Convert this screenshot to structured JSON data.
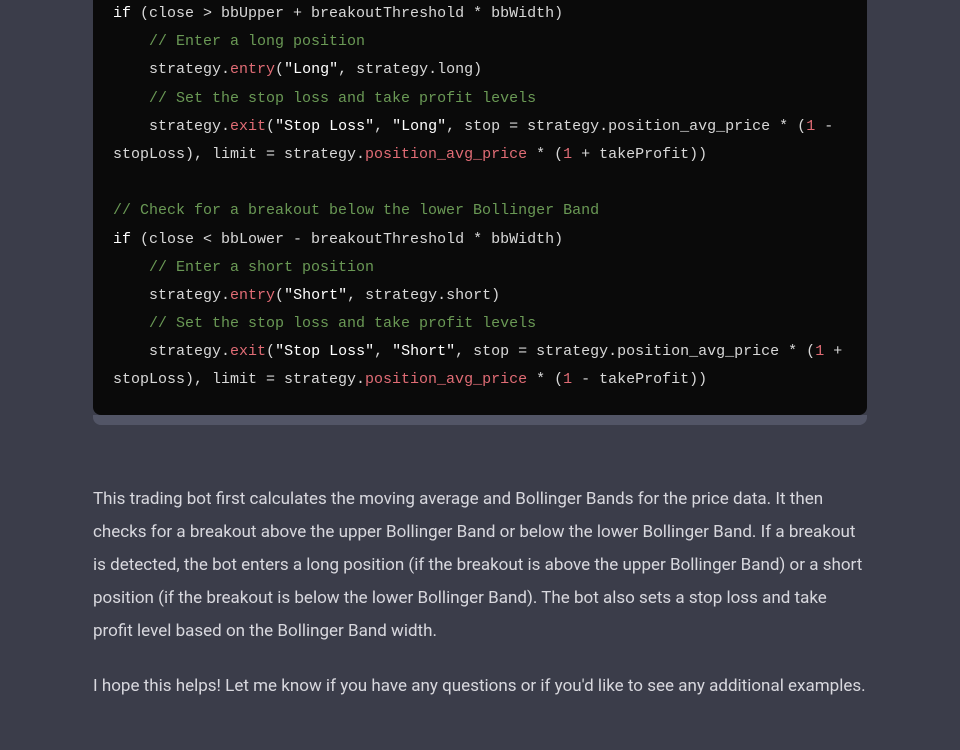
{
  "code": {
    "lines": [
      {
        "indent": 0,
        "segments": [
          {
            "cls": "kw",
            "text": "if"
          },
          {
            "cls": "",
            "text": " (close > bbUpper + breakoutThreshold * bbWidth)"
          }
        ]
      },
      {
        "indent": 1,
        "segments": [
          {
            "cls": "comment",
            "text": "// Enter a long position"
          }
        ]
      },
      {
        "indent": 1,
        "segments": [
          {
            "cls": "",
            "text": "strategy."
          },
          {
            "cls": "method",
            "text": "entry"
          },
          {
            "cls": "",
            "text": "("
          },
          {
            "cls": "str",
            "text": "\"Long\""
          },
          {
            "cls": "",
            "text": ", strategy.long)"
          }
        ]
      },
      {
        "indent": 1,
        "segments": [
          {
            "cls": "comment",
            "text": "// Set the stop loss and take profit levels"
          }
        ]
      },
      {
        "indent": 1,
        "segments": [
          {
            "cls": "",
            "text": "strategy."
          },
          {
            "cls": "method",
            "text": "exit"
          },
          {
            "cls": "",
            "text": "("
          },
          {
            "cls": "str",
            "text": "\"Stop Loss\""
          },
          {
            "cls": "",
            "text": ", "
          },
          {
            "cls": "str",
            "text": "\"Long\""
          },
          {
            "cls": "",
            "text": ", stop = strategy.position_avg_price * ("
          },
          {
            "cls": "num",
            "text": "1"
          },
          {
            "cls": "",
            "text": " - stopLoss), limit = strategy."
          },
          {
            "cls": "method2",
            "text": "position_avg_price"
          },
          {
            "cls": "",
            "text": " * ("
          },
          {
            "cls": "num",
            "text": "1"
          },
          {
            "cls": "",
            "text": " + takeProfit))"
          }
        ]
      },
      {
        "indent": 0,
        "segments": [
          {
            "cls": "",
            "text": ""
          }
        ]
      },
      {
        "indent": 0,
        "segments": [
          {
            "cls": "comment",
            "text": "// Check for a breakout below the lower Bollinger Band"
          }
        ]
      },
      {
        "indent": 0,
        "segments": [
          {
            "cls": "kw",
            "text": "if"
          },
          {
            "cls": "",
            "text": " (close < bbLower - breakoutThreshold * bbWidth)"
          }
        ]
      },
      {
        "indent": 1,
        "segments": [
          {
            "cls": "comment",
            "text": "// Enter a short position"
          }
        ]
      },
      {
        "indent": 1,
        "segments": [
          {
            "cls": "",
            "text": "strategy."
          },
          {
            "cls": "method",
            "text": "entry"
          },
          {
            "cls": "",
            "text": "("
          },
          {
            "cls": "str",
            "text": "\"Short\""
          },
          {
            "cls": "",
            "text": ", strategy.short)"
          }
        ]
      },
      {
        "indent": 1,
        "segments": [
          {
            "cls": "comment",
            "text": "// Set the stop loss and take profit levels"
          }
        ]
      },
      {
        "indent": 1,
        "segments": [
          {
            "cls": "",
            "text": "strategy."
          },
          {
            "cls": "method",
            "text": "exit"
          },
          {
            "cls": "",
            "text": "("
          },
          {
            "cls": "str",
            "text": "\"Stop Loss\""
          },
          {
            "cls": "",
            "text": ", "
          },
          {
            "cls": "str",
            "text": "\"Short\""
          },
          {
            "cls": "",
            "text": ", stop = strategy.position_avg_price * ("
          },
          {
            "cls": "num",
            "text": "1"
          },
          {
            "cls": "",
            "text": " + stopLoss), limit = strategy."
          },
          {
            "cls": "method2",
            "text": "position_avg_price"
          },
          {
            "cls": "",
            "text": " * ("
          },
          {
            "cls": "num",
            "text": "1"
          },
          {
            "cls": "",
            "text": " - takeProfit))"
          }
        ]
      }
    ]
  },
  "prose": {
    "p1": "This trading bot first calculates the moving average and Bollinger Bands for the price data. It then checks for a breakout above the upper Bollinger Band or below the lower Bollinger Band. If a breakout is detected, the bot enters a long position (if the breakout is above the upper Bollinger Band) or a short position (if the breakout is below the lower Bollinger Band). The bot also sets a stop loss and take profit level based on the Bollinger Band width.",
    "p2": "I hope this helps! Let me know if you have any questions or if you'd like to see any additional examples."
  }
}
